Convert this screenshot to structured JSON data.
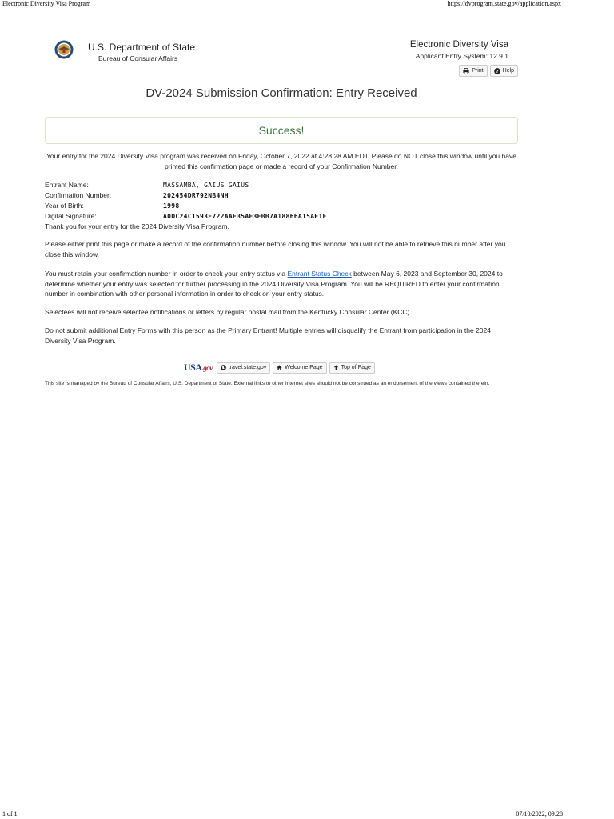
{
  "print_header": {
    "title": "Electronic Diversity Visa Program",
    "url": "https://dvprogram.state.gov/application.aspx"
  },
  "print_footer": {
    "page": "1 of 1",
    "datetime": "07/10/2022, 09:28"
  },
  "header": {
    "department": "U.S. Department of State",
    "bureau": "Bureau of Consular Affairs",
    "app_title": "Electronic Diversity Visa",
    "system_version": "Applicant Entry System: 12.9.1",
    "print_label": "Print",
    "help_label": "Help"
  },
  "page_title": "DV-2024 Submission Confirmation: Entry Received",
  "success_message": "Success!",
  "intro_text": "Your entry for the 2024 Diversity Visa program was received on Friday, October 7, 2022 at 4:28:28 AM EDT. Please do NOT close this window until you have printed this confirmation page or made a record of your Confirmation Number.",
  "details": [
    {
      "label": "Entrant Name:",
      "value": "MASSAMBA, GAIUS GAIUS",
      "bold": false
    },
    {
      "label": "Confirmation Number:",
      "value": "202454DR792NB4NH",
      "bold": true
    },
    {
      "label": "Year of Birth:",
      "value": "1998",
      "bold": true
    },
    {
      "label": "Digital Signature:",
      "value": "A0DC24C1593E722AAE35AE3EBB7A18866A15AE1E",
      "bold": true
    }
  ],
  "paragraphs": {
    "thanks": "Thank you for your entry for the 2024 Diversity Visa Program.",
    "print_notice": "Please either print this page or make a record of the confirmation number before closing this window. You will not be able to retrieve this number after you close this window.",
    "retain_before": "You must retain your confirmation number in order to check your entry status via ",
    "retain_link": "Entrant Status Check",
    "retain_after": " between May 6, 2023 and September 30, 2024 to determine whether your entry was selected for further processing in the 2024 Diversity Visa Program. You will be REQUIRED to enter your confirmation number in combination with other personal information in order to check on your entry status.",
    "selectees": "Selectees will not receive selectee notifications or letters by regular postal mail from the Kentucky Consular Center (KCC).",
    "no_additional": "Do not submit additional Entry Forms with this person as the Primary Entrant! Multiple entries will disqualify the Entrant from participation in the 2024 Diversity Visa Program."
  },
  "footer": {
    "usa_logo_main": "USA",
    "usa_logo_suffix": ".gov",
    "travel_link": "travel.state.gov",
    "welcome_link": "Welcome Page",
    "top_link": "Top of Page",
    "disclaimer": "This site is managed by the Bureau of Consular Affairs, U.S. Department of State. External links to other Internet sites should not be construed as an endorsement of the views contained therein."
  },
  "colors": {
    "success_text": "#3c763d",
    "success_border": "#d6e9c6",
    "link": "#1a5fb4"
  }
}
